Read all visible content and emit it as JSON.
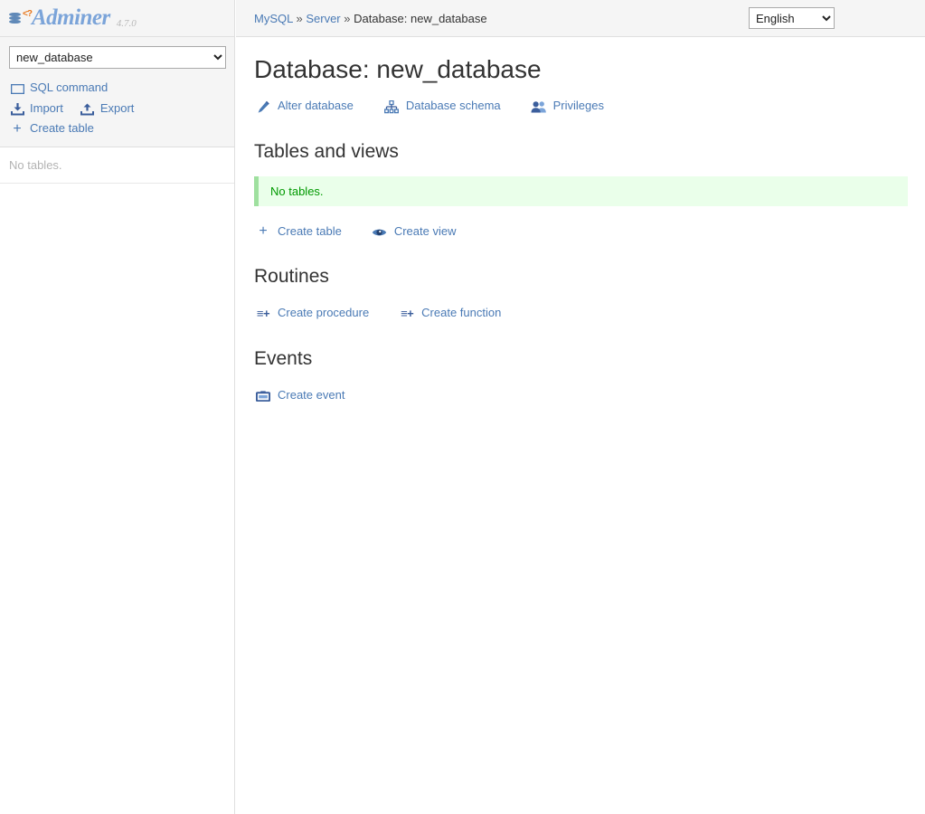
{
  "brand": {
    "name": "Adminer",
    "version": "4.7.0",
    "php_mark": "<?",
    "logo_color": "#7ba4d9",
    "accent_color": "#e8761a"
  },
  "sidebar": {
    "db_select": {
      "value": "new_database",
      "options": [
        "new_database"
      ]
    },
    "links": [
      {
        "label": "SQL command",
        "icon": "sql-command-icon"
      },
      {
        "label": "Import",
        "icon": "import-icon"
      },
      {
        "label": "Export",
        "icon": "export-icon"
      },
      {
        "label": "Create table",
        "icon": "plus-icon"
      }
    ],
    "tables_empty_text": "No tables."
  },
  "header": {
    "breadcrumb": {
      "server_type": "MySQL",
      "sep1": "»",
      "server": "Server",
      "sep2": "»",
      "current": "Database: new_database"
    },
    "language": {
      "value": "English",
      "options": [
        "English"
      ]
    }
  },
  "main": {
    "title": "Database: new_database",
    "actions": [
      {
        "label": "Alter database",
        "icon": "pencil-icon"
      },
      {
        "label": "Database schema",
        "icon": "schema-tree-icon"
      },
      {
        "label": "Privileges",
        "icon": "users-icon"
      }
    ],
    "tables_section": {
      "heading": "Tables and views",
      "message": "No tables.",
      "message_color": "#009900",
      "message_bg": "#eaffea",
      "links": [
        {
          "label": "Create table",
          "icon": "plus-icon"
        },
        {
          "label": "Create view",
          "icon": "eye-icon"
        }
      ]
    },
    "routines_section": {
      "heading": "Routines",
      "links": [
        {
          "label": "Create procedure",
          "icon": "list-plus-icon"
        },
        {
          "label": "Create function",
          "icon": "list-plus-icon"
        }
      ]
    },
    "events_section": {
      "heading": "Events",
      "links": [
        {
          "label": "Create event",
          "icon": "calendar-icon"
        }
      ]
    }
  }
}
